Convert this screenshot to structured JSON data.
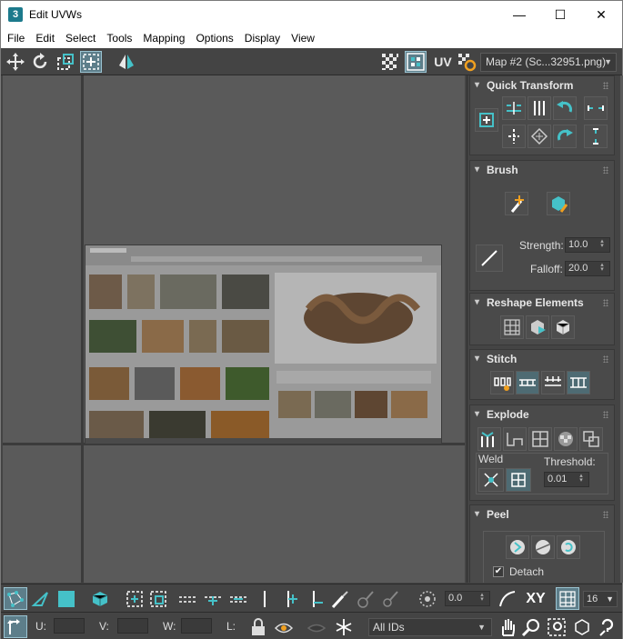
{
  "window": {
    "title": "Edit UVWs",
    "app_icon": "3",
    "minimize": "—",
    "maximize": "☐",
    "close": "✕"
  },
  "menu": [
    "File",
    "Edit",
    "Select",
    "Tools",
    "Mapping",
    "Options",
    "Display",
    "View"
  ],
  "toolbar": {
    "uv_label": "UV",
    "map_select": "Map #2 (Sc...32951.png)"
  },
  "panel": {
    "quick_transform": {
      "title": "Quick Transform"
    },
    "brush": {
      "title": "Brush",
      "strength_label": "Strength:",
      "strength_value": "10.0",
      "falloff_label": "Falloff:",
      "falloff_value": "20.0"
    },
    "reshape": {
      "title": "Reshape Elements"
    },
    "stitch": {
      "title": "Stitch"
    },
    "explode": {
      "title": "Explode",
      "weld_label": "Weld",
      "threshold_label": "Threshold:",
      "threshold_value": "0.01"
    },
    "peel": {
      "title": "Peel",
      "detach_label": "Detach",
      "detach_checked": "✔"
    }
  },
  "bottom": {
    "angle_value": "0.0",
    "xy_label": "XY",
    "grid_value": "16",
    "u_label": "U:",
    "v_label": "V:",
    "w_label": "W:",
    "l_label": "L:",
    "ids_select": "All IDs"
  },
  "colors": {
    "accent": "#45c1c8",
    "panel_bg": "#444444",
    "viewport_bg": "#5a5a5a"
  }
}
